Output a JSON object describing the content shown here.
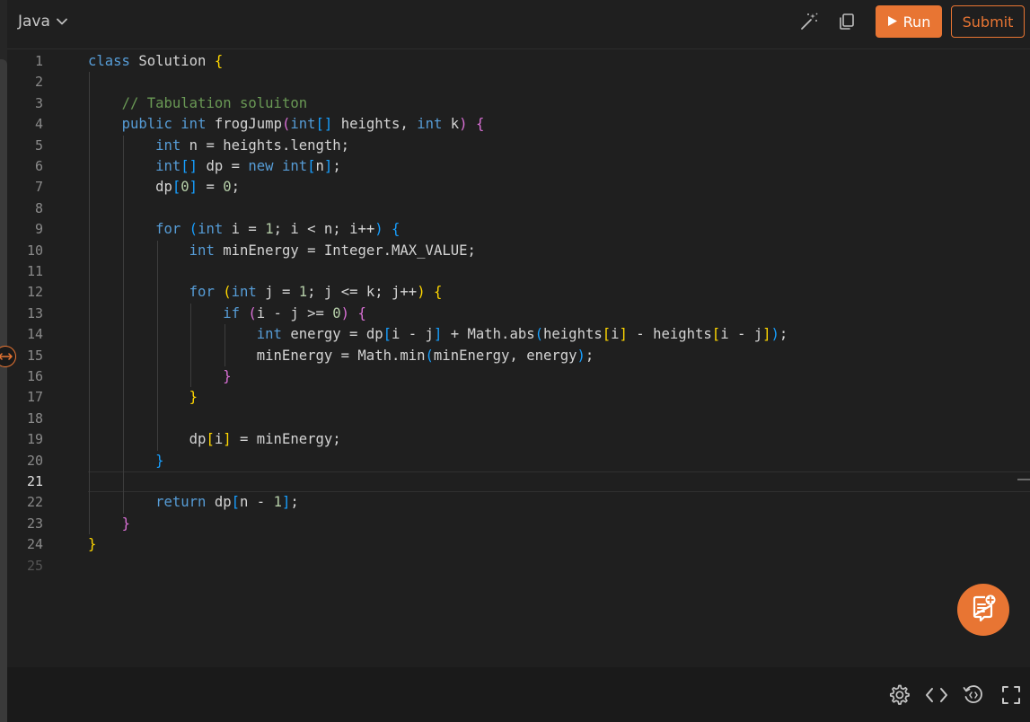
{
  "toolbar": {
    "language": "Java",
    "run_label": "Run",
    "submit_label": "Submit"
  },
  "editor": {
    "active_line": 21,
    "lines": [
      "1",
      "2",
      "3",
      "4",
      "5",
      "6",
      "7",
      "8",
      "9",
      "10",
      "11",
      "12",
      "13",
      "14",
      "15",
      "16",
      "17",
      "18",
      "19",
      "20",
      "21",
      "22",
      "23",
      "24",
      "25"
    ],
    "code": [
      "class Solution {",
      "",
      "    // Tabulation soluiton",
      "    public int frogJump(int[] heights, int k) {",
      "        int n = heights.length;",
      "        int[] dp = new int[n];",
      "        dp[0] = 0;",
      "",
      "        for (int i = 1; i < n; i++) {",
      "            int minEnergy = Integer.MAX_VALUE;",
      "",
      "            for (int j = 1; j <= k; j++) {",
      "                if (i - j >= 0) {",
      "                    int energy = dp[i - j] + Math.abs(heights[i] - heights[i - j]);",
      "                    minEnergy = Math.min(minEnergy, energy);",
      "                }",
      "            }",
      "",
      "            dp[i] = minEnergy;",
      "        }",
      "",
      "        return dp[n - 1];",
      "    }",
      "}",
      ""
    ]
  },
  "icons": {
    "toolbar": [
      "chevron-down-icon",
      "magic-wand-icon",
      "copy-icon",
      "play-icon"
    ],
    "bottom": [
      "settings-icon",
      "code-brackets-icon",
      "reset-icon",
      "fullscreen-icon"
    ],
    "fab": "add-note-icon",
    "resize": "resize-horizontal-icon"
  },
  "colors": {
    "accent": "#e87533",
    "background": "#1f1f1f",
    "keyword": "#569cd6",
    "comment": "#6a9955",
    "number": "#b5cea8",
    "bracket_level1": "#ffd700",
    "bracket_level2": "#da70d6",
    "bracket_level3": "#179fff"
  }
}
